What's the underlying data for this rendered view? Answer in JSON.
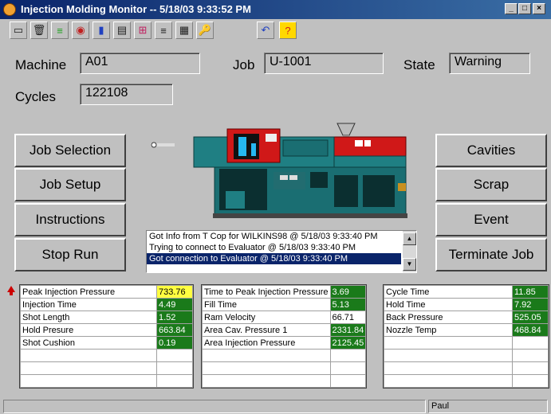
{
  "window": {
    "title": "Injection Molding Monitor -- 5/18/03 9:33:52 PM"
  },
  "toolbar": {
    "icons": [
      "monitor-icon",
      "trash-icon",
      "palette-icon",
      "record-icon",
      "chart-icon",
      "document-icon",
      "grid-icon",
      "list-icon",
      "report-icon",
      "key-icon",
      "undo-icon",
      "help-icon"
    ],
    "glyphs": [
      "▭",
      "🗑",
      "≡",
      "◉",
      "▮",
      "▤",
      "⊞",
      "≡",
      "▦",
      "🔑",
      "↶",
      "?"
    ]
  },
  "header": {
    "machine_label": "Machine",
    "machine_value": "A01",
    "job_label": "Job",
    "job_value": "U-1001",
    "state_label": "State",
    "state_value": "Warning",
    "cycles_label": "Cycles",
    "cycles_value": "122108"
  },
  "left_buttons": [
    "Job Selection",
    "Job Setup",
    "Instructions",
    "Stop Run"
  ],
  "right_buttons": [
    "Cavities",
    "Scrap",
    "Event",
    "Terminate Job"
  ],
  "log": [
    "Got Info from T Cop for WILKINS98 @ 5/18/03 9:33:40 PM",
    "Trying to connect to Evaluator @ 5/18/03 9:33:40 PM",
    "Got connection to Evaluator @ 5/18/03 9:33:40 PM"
  ],
  "log_selected_index": 2,
  "panels": [
    {
      "rows": [
        {
          "label": "Peak Injection Pressure",
          "value": "733.76",
          "status": "yellow"
        },
        {
          "label": "Injection Time",
          "value": "4.49",
          "status": "green"
        },
        {
          "label": "Shot Length",
          "value": "1.52",
          "status": "green"
        },
        {
          "label": "Hold Presure",
          "value": "663.84",
          "status": "green"
        },
        {
          "label": "Shot Cushion",
          "value": "0.19",
          "status": "green"
        }
      ]
    },
    {
      "rows": [
        {
          "label": "Time to Peak Injection Pressure",
          "value": "3.69",
          "status": "green"
        },
        {
          "label": "Fill Time",
          "value": "5.13",
          "status": "green"
        },
        {
          "label": "Ram Velocity",
          "value": "66.71",
          "status": "plain"
        },
        {
          "label": "Area Cav. Pressure 1",
          "value": "2331.84",
          "status": "green"
        },
        {
          "label": "Area Injection Pressure",
          "value": "2125.45",
          "status": "green"
        }
      ]
    },
    {
      "rows": [
        {
          "label": "Cycle Time",
          "value": "11.85",
          "status": "green"
        },
        {
          "label": "Hold Time",
          "value": "7.92",
          "status": "green"
        },
        {
          "label": "Back Pressure",
          "value": "525.05",
          "status": "green"
        },
        {
          "label": "Nozzle Temp",
          "value": "468.84",
          "status": "green"
        }
      ]
    }
  ],
  "status": {
    "user": "Paul"
  },
  "colors": {
    "title_bar": "#0a246a",
    "value_ok": "#1a7a1a",
    "value_warning": "#ffff40",
    "alert": "#cc0000"
  }
}
